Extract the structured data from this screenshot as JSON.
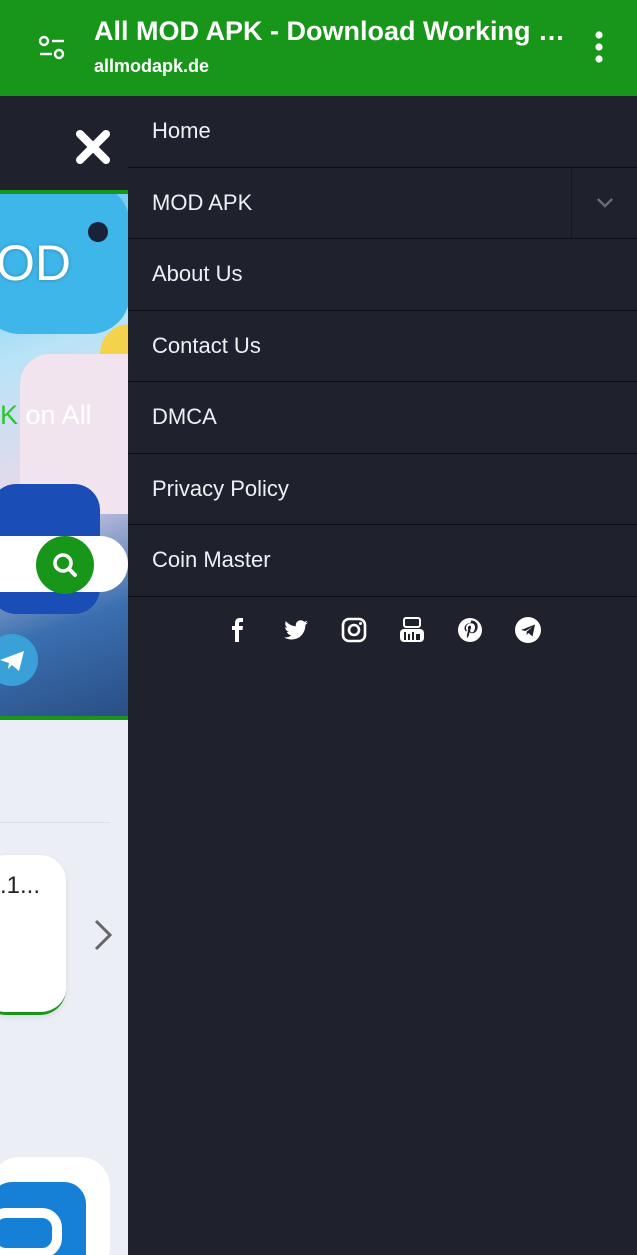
{
  "browser": {
    "title": "All MOD APK - Download Working MOD APK on All Apps and Games",
    "url": "allmodapk.de"
  },
  "background_page": {
    "hero_text": "OD",
    "hero_sub_green": "K",
    "hero_sub": " on All",
    "card_text": ".1..."
  },
  "drawer": {
    "items": [
      {
        "label": "Home"
      },
      {
        "label": "MOD APK"
      },
      {
        "label": "About Us"
      },
      {
        "label": "Contact Us"
      },
      {
        "label": "DMCA"
      },
      {
        "label": "Privacy Policy"
      },
      {
        "label": "Coin Master"
      }
    ],
    "socials": [
      "facebook-icon",
      "twitter-icon",
      "instagram-icon",
      "youtube-icon",
      "pinterest-icon",
      "telegram-icon"
    ]
  },
  "colors": {
    "accent": "#17961a",
    "drawer_bg": "#1f212d",
    "text": "#eef0f4"
  }
}
